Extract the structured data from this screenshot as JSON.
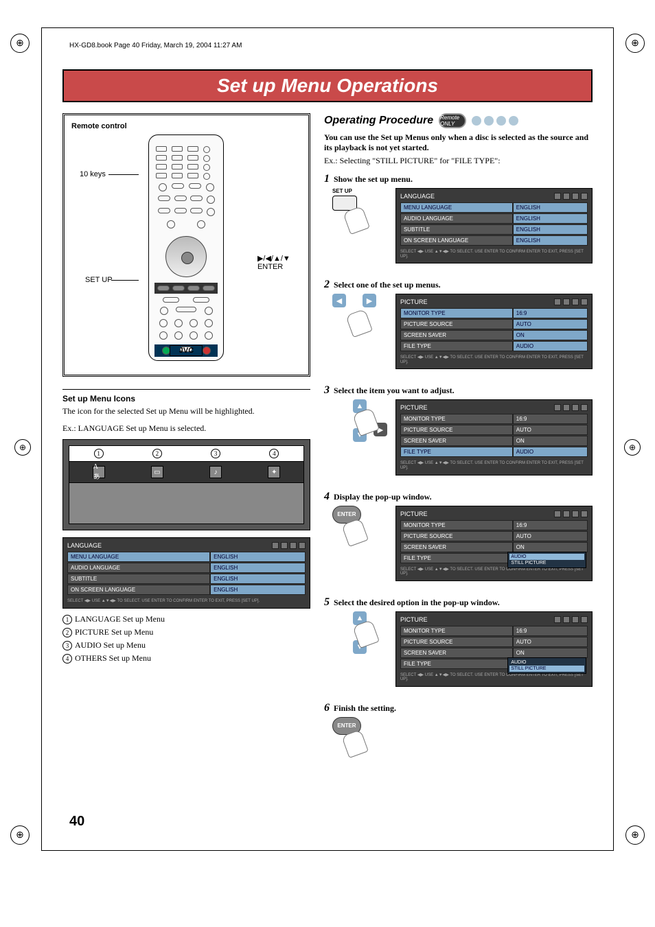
{
  "book_header": "HX-GD8.book  Page 40  Friday, March 19, 2004  11:27 AM",
  "banner_title": "Set up Menu Operations",
  "remote": {
    "title": "Remote control",
    "label_10keys": "10 keys",
    "label_setup": "SET UP",
    "label_enter_arrows": "▶/◀/▲/▼",
    "label_enter": "ENTER",
    "brand": "JVC"
  },
  "icons_section": {
    "heading": "Set up Menu Icons",
    "desc": "The icon for the selected Set up Menu will be highlighted.",
    "example": "Ex.: LANGUAGE Set up Menu is selected.",
    "nums": [
      "1",
      "2",
      "3",
      "4"
    ],
    "list": [
      "LANGUAGE Set up Menu",
      "PICTURE Set up Menu",
      "AUDIO Set up Menu",
      "OTHERS Set up Menu"
    ]
  },
  "osd_language": {
    "title": "LANGUAGE",
    "rows": [
      {
        "label": "MENU LANGUAGE",
        "value": "ENGLISH",
        "active": true
      },
      {
        "label": "AUDIO LANGUAGE",
        "value": "ENGLISH"
      },
      {
        "label": "SUBTITLE",
        "value": "ENGLISH"
      },
      {
        "label": "ON SCREEN LANGUAGE",
        "value": "ENGLISH"
      }
    ],
    "hint": "SELECT ◀▶  USE ▲▼◀▶ TO SELECT. USE ENTER TO CONFIRM\nENTER       TO EXIT, PRESS [SET UP]."
  },
  "right": {
    "heading": "Operating Procedure",
    "badge": "Remote ONLY",
    "intro_bold": "You can use the Set up Menus only when a disc is selected as the source and its playback is not yet started.",
    "intro_ex": "Ex.: Selecting \"STILL PICTURE\" for \"FILE TYPE\":",
    "steps": [
      {
        "num": "1",
        "title": "Show the set up menu.",
        "key_label": "SET UP"
      },
      {
        "num": "2",
        "title": "Select one of the set up menus."
      },
      {
        "num": "3",
        "title": "Select the item you want to adjust."
      },
      {
        "num": "4",
        "title": "Display the pop-up window.",
        "key_label": "ENTER"
      },
      {
        "num": "5",
        "title": "Select the desired option in the pop-up window."
      },
      {
        "num": "6",
        "title": "Finish the setting.",
        "key_label": "ENTER"
      }
    ],
    "osd_picture": {
      "title": "PICTURE",
      "rows": [
        {
          "label": "MONITOR TYPE",
          "value": "16:9"
        },
        {
          "label": "PICTURE SOURCE",
          "value": "AUTO"
        },
        {
          "label": "SCREEN SAVER",
          "value": "ON"
        },
        {
          "label": "FILE TYPE",
          "value": "AUDIO"
        }
      ],
      "popup_items": [
        "AUDIO",
        "STILL PICTURE"
      ],
      "hint": "SELECT ◀▶  USE ▲▼◀▶ TO SELECT. USE ENTER TO CONFIRM\nENTER       TO EXIT, PRESS [SET UP]."
    }
  },
  "page_number": "40"
}
